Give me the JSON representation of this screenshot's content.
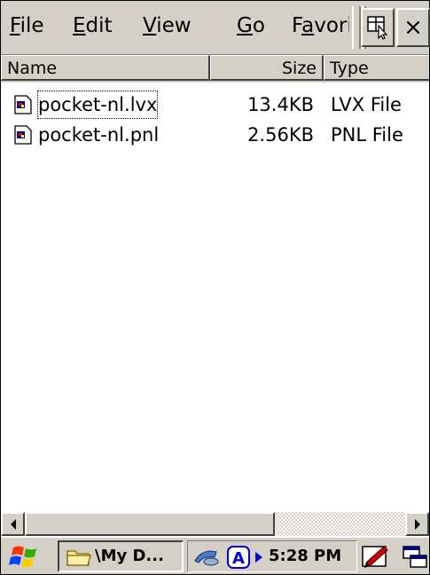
{
  "menu": {
    "file": {
      "accel": "F",
      "rest": "ile"
    },
    "edit": {
      "accel": "E",
      "rest": "dit"
    },
    "view": {
      "accel": "V",
      "rest": "iew"
    },
    "go": {
      "accel": "G",
      "rest": "o"
    },
    "favorites": {
      "pre": "F",
      "accel": "a",
      "rest": "vorites"
    }
  },
  "toolbar": {
    "close_label": "×",
    "view_icon": "view-toggle-icon"
  },
  "list": {
    "columns": {
      "name": "Name",
      "size": "Size",
      "type": "Type"
    },
    "rows": [
      {
        "name": "pocket-nl.lvx",
        "size": "13.4KB",
        "type": "LVX File",
        "icon": "file-icon"
      },
      {
        "name": "pocket-nl.pnl",
        "size": "2.56KB",
        "type": "PNL File",
        "icon": "file-icon"
      }
    ]
  },
  "scrollbar": {
    "left_icon": "arrow-left-icon",
    "right_icon": "arrow-right-icon"
  },
  "taskbar": {
    "start_icon": "windows-flag-icon",
    "task_label": "\\My D...",
    "task_icon": "folder-icon",
    "clock": "5:28 PM",
    "tray_icons": [
      "network-icon",
      "input-a-icon",
      "play-arrow-icon",
      "pen-icon",
      "desktop-icon"
    ]
  },
  "colors": {
    "chrome": "#d4d0c8",
    "shadow": "#808080",
    "dark_shadow": "#404040",
    "highlight": "#ffffff"
  }
}
